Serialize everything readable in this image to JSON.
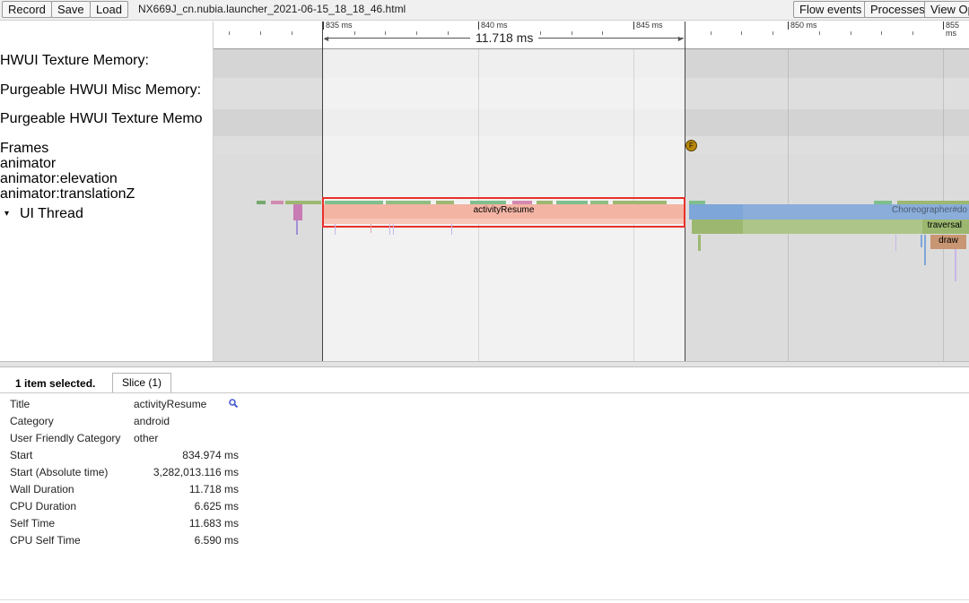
{
  "toolbar": {
    "record_label": "Record",
    "save_label": "Save",
    "load_label": "Load",
    "filename": "NX669J_cn.nubia.launcher_2021-06-15_18_18_46.html",
    "flow_events_label": "Flow events",
    "processes_label": "Processes",
    "view_options_label": "View Op"
  },
  "tracks": {
    "labels": [
      "HWUI Texture Memory:",
      "Purgeable HWUI Misc Memory:",
      "Purgeable HWUI Texture Memo",
      "Frames",
      "animator",
      "animator:elevation",
      "animator:translationZ",
      "UI Thread"
    ],
    "expand_glyph": "▾"
  },
  "ruler": {
    "ticks": [
      "835 ms",
      "840 ms",
      "845 ms",
      "850 ms",
      "855 ms"
    ],
    "range_label": "11.718 ms"
  },
  "timeline": {
    "frame_marker": "F",
    "selected_slice": "activityResume",
    "slices": [
      "Choreographer#do",
      "traversal",
      "draw"
    ]
  },
  "colors": {
    "selection_highlight": "#e8302a",
    "activity_resume": "#f4b4a4",
    "choreographer": "#7ea6d8",
    "traversal": "#9cb870",
    "draw": "#c89672",
    "frame_marker": "#b8860b"
  },
  "panel": {
    "selection_count": "1 item selected.",
    "tab_label": "Slice (1)",
    "rows": [
      {
        "label": "Title",
        "value": "activityResume"
      },
      {
        "label": "Category",
        "value": "android"
      },
      {
        "label": "User Friendly Category",
        "value": "other"
      },
      {
        "label": "Start",
        "value": "834.974 ms"
      },
      {
        "label": "Start (Absolute time)",
        "value": "3,282,013.116 ms"
      },
      {
        "label": "Wall Duration",
        "value": "11.718 ms"
      },
      {
        "label": "CPU Duration",
        "value": "6.625 ms"
      },
      {
        "label": "Self Time",
        "value": "11.683 ms"
      },
      {
        "label": "CPU Self Time",
        "value": "6.590 ms"
      }
    ]
  }
}
